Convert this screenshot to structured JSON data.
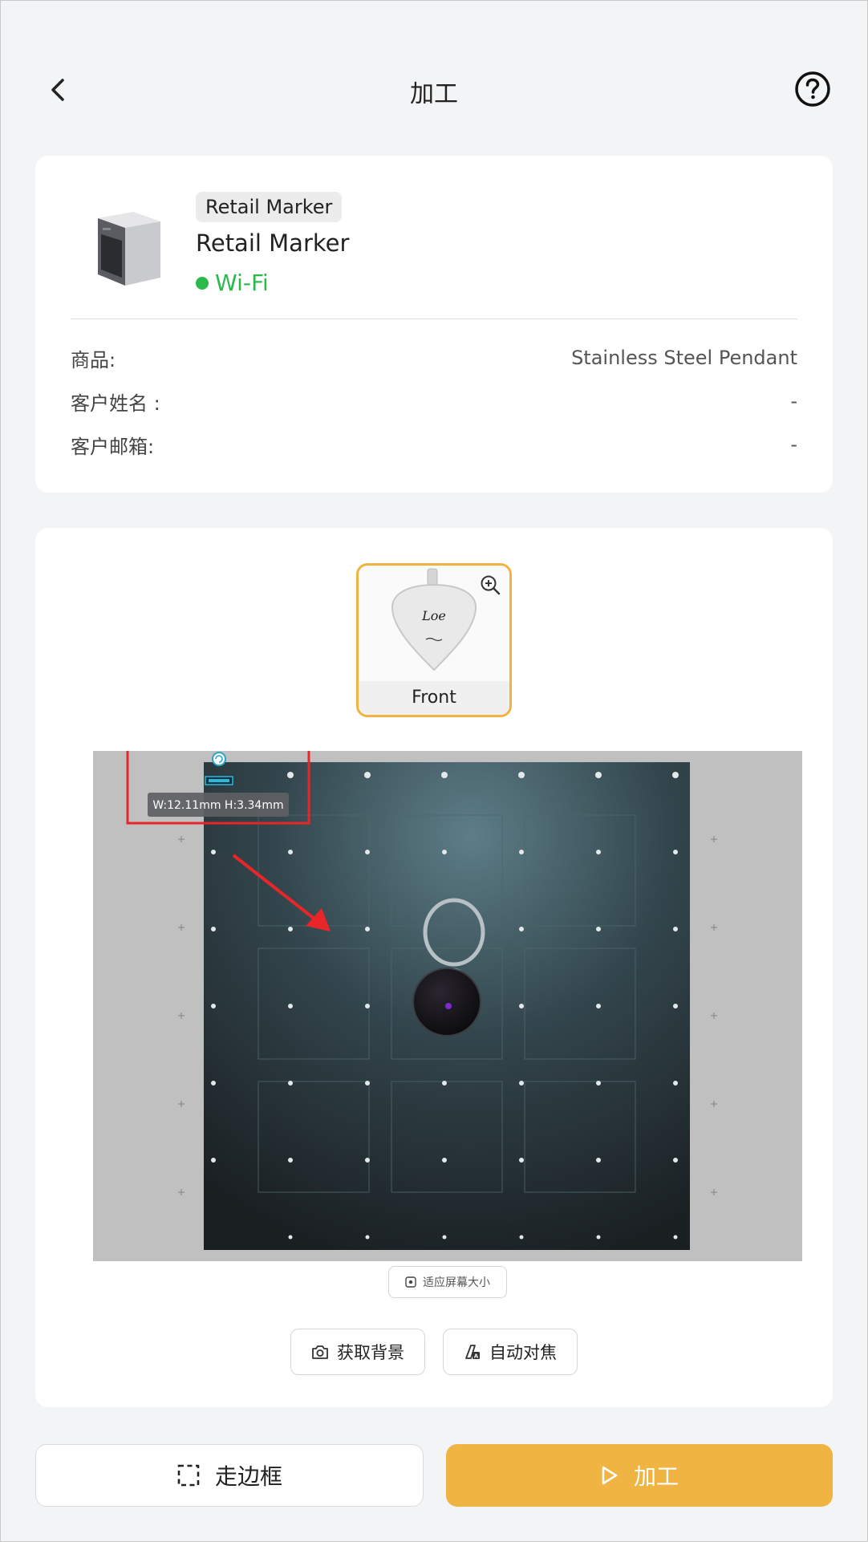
{
  "header": {
    "title": "加工"
  },
  "device": {
    "badge": "Retail Marker",
    "name": "Retail Marker",
    "connection": "Wi-Fi",
    "connection_color": "#2db84c"
  },
  "order": {
    "rows": [
      {
        "label": "商品:",
        "value": "Stainless Steel Pendant"
      },
      {
        "label": "客户姓名 :",
        "value": "-"
      },
      {
        "label": "客户邮箱:",
        "value": "-"
      }
    ]
  },
  "preview": {
    "side_label": "Front",
    "engraving_text": "Loe",
    "dimensions_label": "W:12.11mm H:3.34mm",
    "fit_screen_label": "适应屏幕大小"
  },
  "tools": {
    "get_background": "获取背景",
    "auto_focus": "自动对焦"
  },
  "actions": {
    "frame_label": "走边框",
    "process_label": "加工"
  },
  "colors": {
    "accent": "#efb442",
    "thumb_border": "#f0b340",
    "annotation_red": "#e8262a"
  },
  "icons": {
    "back": "chevron-left-icon",
    "help": "question-circle-icon",
    "zoom": "zoom-in-icon",
    "camera": "camera-icon",
    "focus": "auto-focus-icon",
    "frame": "dashed-frame-icon",
    "play": "play-icon",
    "fit": "fit-screen-icon"
  }
}
